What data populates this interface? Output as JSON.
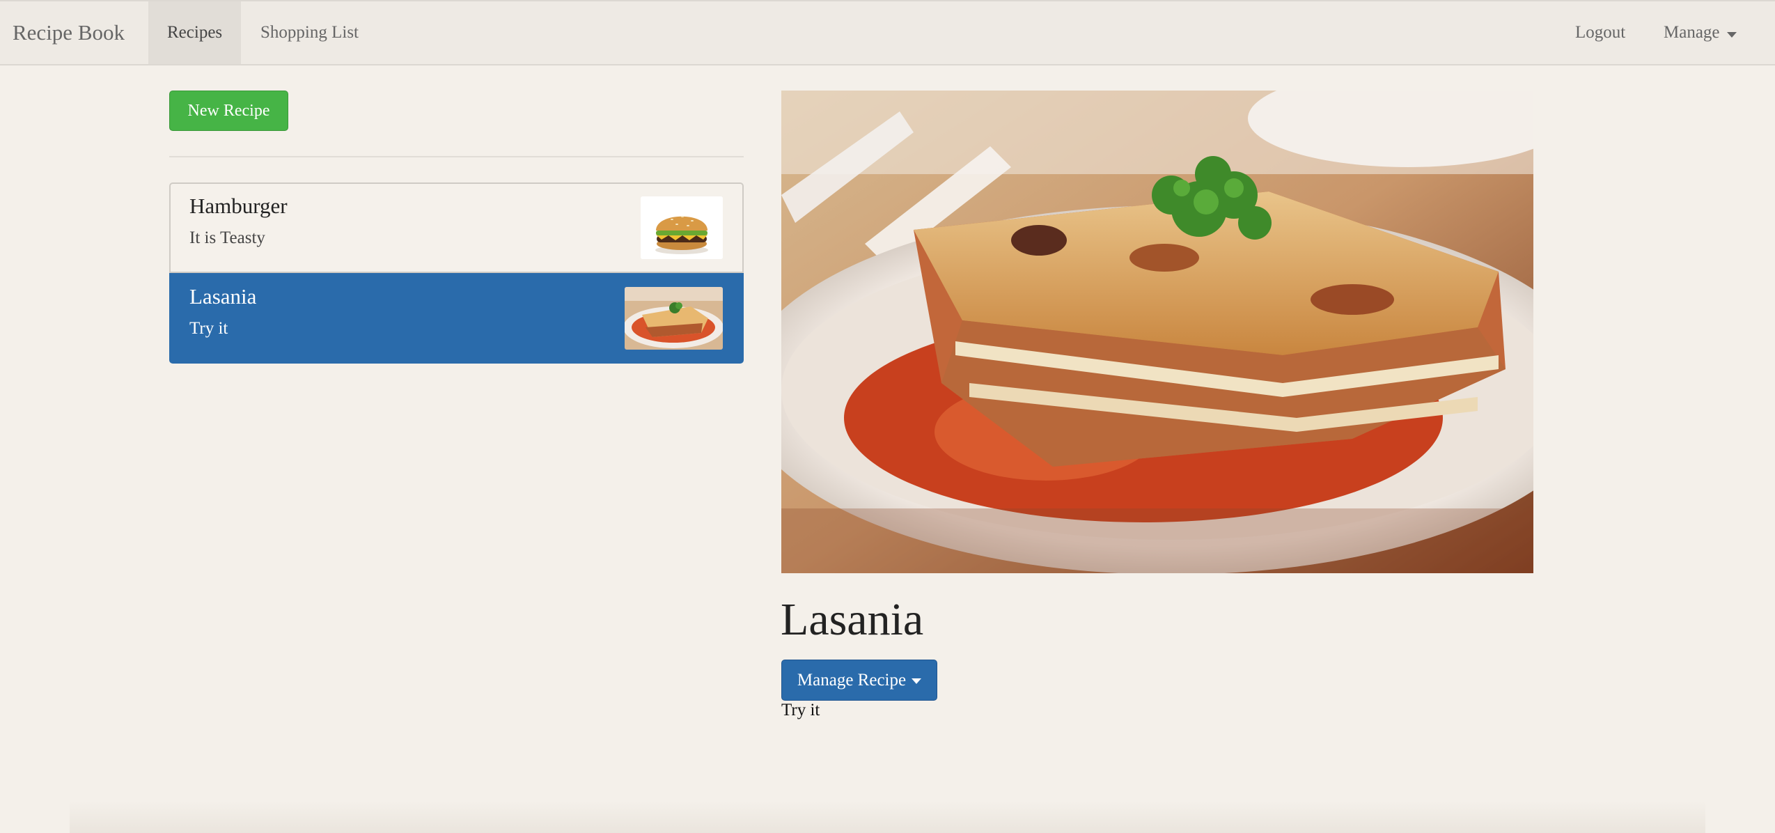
{
  "navbar": {
    "brand": "Recipe Book",
    "links": [
      "Recipes",
      "Shopping List"
    ],
    "logout": "Logout",
    "manage": "Manage"
  },
  "sidebar": {
    "new_button": "New Recipe",
    "recipes": [
      {
        "name": "Hamburger",
        "description": "It is Teasty",
        "image": "hamburger-thumbnail",
        "active": false
      },
      {
        "name": "Lasania",
        "description": "Try it",
        "image": "lasagna-thumbnail",
        "active": true
      }
    ]
  },
  "detail": {
    "image": "lasagna-photo",
    "title": "Lasania",
    "manage_button": "Manage Recipe",
    "description": "Try it"
  },
  "colors": {
    "accent": "#2a6bab",
    "success": "#46b446",
    "background": "#f4f0ea",
    "navbar": "#eeeae4"
  }
}
